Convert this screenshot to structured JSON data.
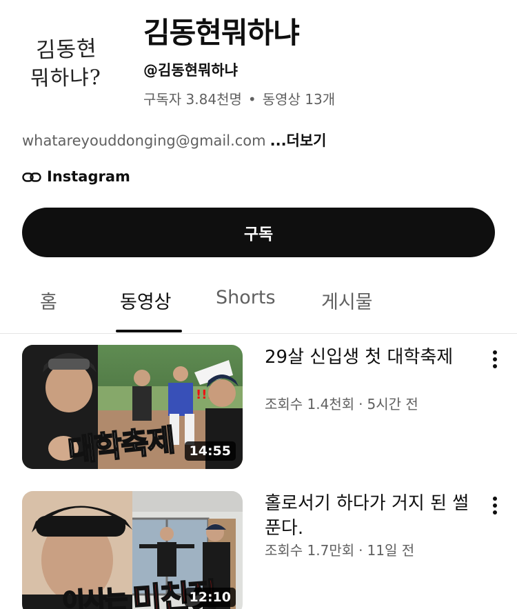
{
  "channel": {
    "avatar_text_line1": "김동현",
    "avatar_text_line2": "뭐하냐?",
    "title": "김동현뭐하냐",
    "handle": "@김동현뭐하냐",
    "subscribers": "구독자 3.84천명",
    "stat_separator": "•",
    "video_count": "동영상 13개",
    "description": "whatareyouddonging@gmail.com",
    "more_label": "...더보기",
    "link_label": "Instagram",
    "link_icon": "link-icon"
  },
  "subscribe_label": "구독",
  "tabs": [
    {
      "label": "홈",
      "active": false
    },
    {
      "label": "동영상",
      "active": true
    },
    {
      "label": "Shorts",
      "active": false
    },
    {
      "label": "게시물",
      "active": false
    }
  ],
  "videos": [
    {
      "title": "29살 신입생 첫 대학축제",
      "views": "조회수 1.4천회",
      "meta_separator": "·",
      "age": "5시간 전",
      "duration": "14:55",
      "thumb_caption": "대학축제"
    },
    {
      "title": "홀로서기 하다가 거지 된 썰 푼다.",
      "views": "조회수 1.7만회",
      "meta_separator": "·",
      "age": "11일 전",
      "duration": "12:10",
      "thumb_caption_white": "이사는",
      "thumb_caption_red": "미친짓"
    }
  ],
  "colors": {
    "text_primary": "#0f0f0f",
    "text_secondary": "#606060",
    "subscribe_bg": "#0f0f0f",
    "subscribe_text": "#ffffff",
    "caption_red": "#e01515"
  }
}
